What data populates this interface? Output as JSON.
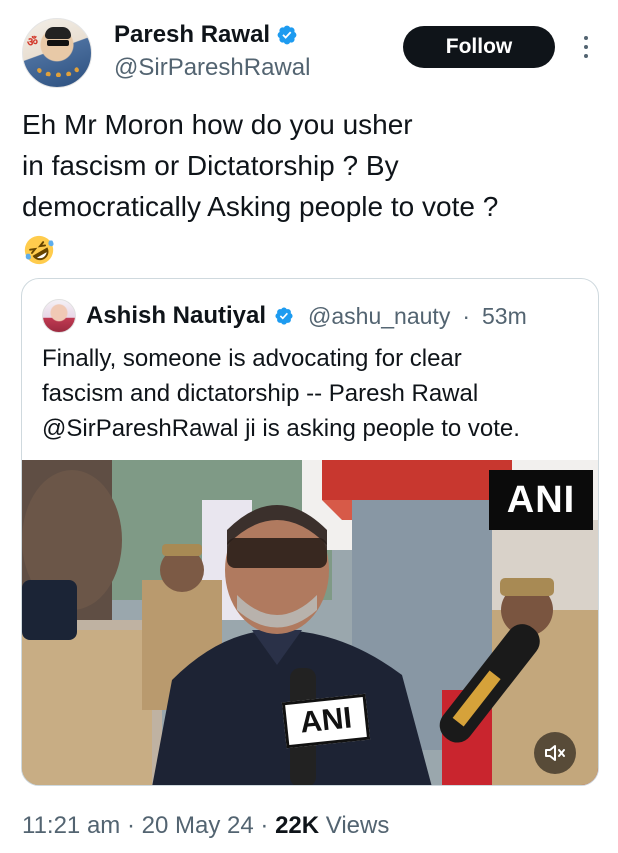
{
  "author": {
    "display_name": "Paresh Rawal",
    "handle": "@SirPareshRawal",
    "verified": true,
    "avatar_icon": "profile-photo"
  },
  "actions": {
    "follow_label": "Follow",
    "more_icon": "more-options-icon"
  },
  "tweet": {
    "lines": [
      "Eh Mr Moron how do you usher",
      "in fascism or Dictatorship ? By",
      "democratically Asking people to vote  ?"
    ],
    "emoji": "rolling-on-floor-laughing-emoji"
  },
  "quote": {
    "display_name": "Ashish Nautiyal",
    "handle": "@ashu_nauty",
    "separator": "·",
    "time": "53m",
    "lines": [
      "Finally, someone is advocating for clear",
      "fascism and dictatorship -- Paresh Rawal",
      "@SirPareshRawal ji is asking people to vote."
    ],
    "media": {
      "watermark": "ANI",
      "mic_label": "ANI",
      "mute_icon": "volume-mute-icon"
    }
  },
  "meta": {
    "time": "11:21 am",
    "sep1": "·",
    "date": "20 May 24",
    "sep2": "·",
    "views_count": "22K",
    "views_label": "Views"
  },
  "colors": {
    "text_primary": "#0f1419",
    "text_secondary": "#536471",
    "verified_blue": "#1d9bf0",
    "border": "#cfd9de",
    "follow_bg": "#0f1419"
  }
}
